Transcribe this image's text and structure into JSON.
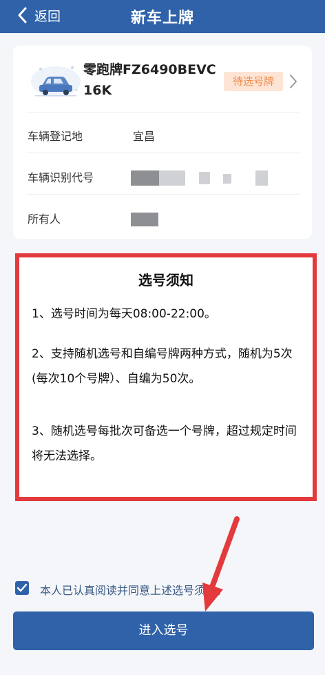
{
  "header": {
    "back_label": "返回",
    "title": "新车上牌"
  },
  "vehicle": {
    "plate_name": "零跑牌FZ6490BEVC",
    "model": "16K",
    "status": "待选号牌",
    "rows": [
      {
        "label": "车辆登记地",
        "value": "宜昌"
      },
      {
        "label": "车辆识别代号",
        "value": ""
      },
      {
        "label": "所有人",
        "value": ""
      }
    ]
  },
  "notice": {
    "title": "选号须知",
    "items": [
      "1、选号时间为每天08:00-22:00。",
      "2、支持随机选号和自编号牌两种方式，随机为5次(每次10个号牌）、自编为50次。",
      "3、随机选号每批次可备选一个号牌，超过规定时间将无法选择。"
    ]
  },
  "agreement": {
    "checked": true,
    "text": "本人已认真阅读并同意上述选号须知。"
  },
  "button": {
    "label": "进入选号"
  },
  "colors": {
    "primary": "#2f62a8",
    "badge_bg": "#fde4d4",
    "badge_text": "#f08a4b",
    "highlight": "#e23a3d"
  }
}
